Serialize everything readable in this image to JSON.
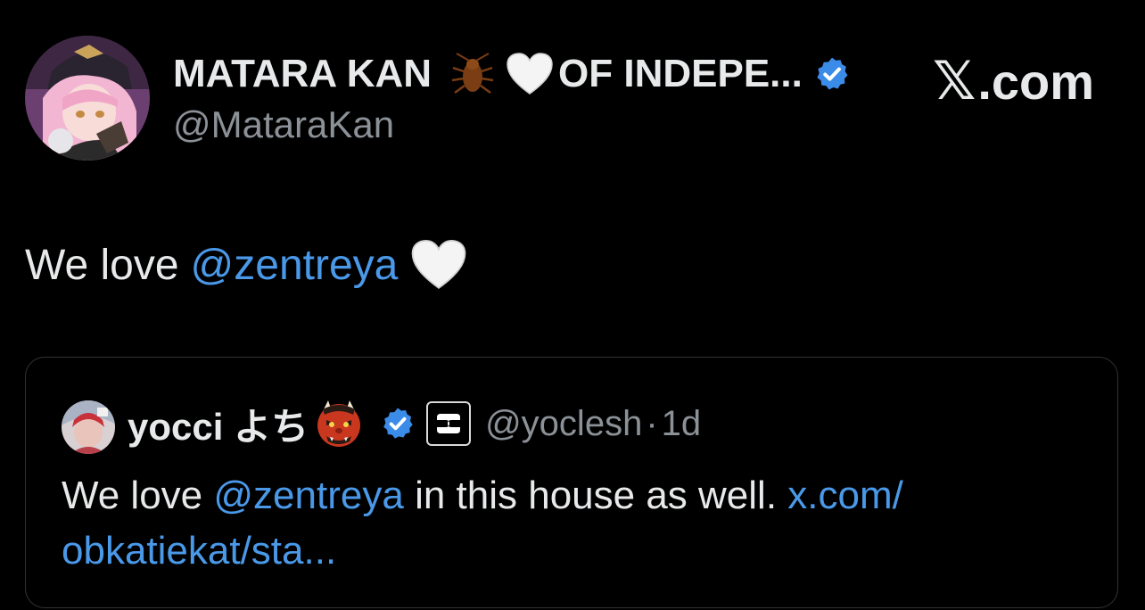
{
  "author": {
    "name_part1": "MATARA KAN",
    "name_part2": "OF INDEPE...",
    "handle": "@MataraKan",
    "name_emojis": [
      "cockroach-emoji",
      "white-heart-emoji"
    ],
    "verified": true,
    "verified_color": "#3b8ce8"
  },
  "brand": {
    "x_glyph": "𝕏",
    "label": ".com"
  },
  "tweet": {
    "text_prefix": "We love",
    "mention": "@zentreya",
    "trailing_emoji": "white-heart-emoji"
  },
  "quote": {
    "name": "yocci よち",
    "name_emoji": "ogre-emoji",
    "verified": true,
    "affiliate_badge": "ss-logo",
    "handle": "@yoclesh",
    "separator": "·",
    "time": "1d",
    "text_prefix": "We love",
    "mention": "@zentreya",
    "text_middle": "in this house as well.",
    "link_line1": "x.com/",
    "link_line2": "obkatiekat/sta..."
  },
  "colors": {
    "background": "#000000",
    "text": "#e7e9ea",
    "muted": "#8b9197",
    "link": "#4a99e9",
    "border": "#2f3336"
  }
}
